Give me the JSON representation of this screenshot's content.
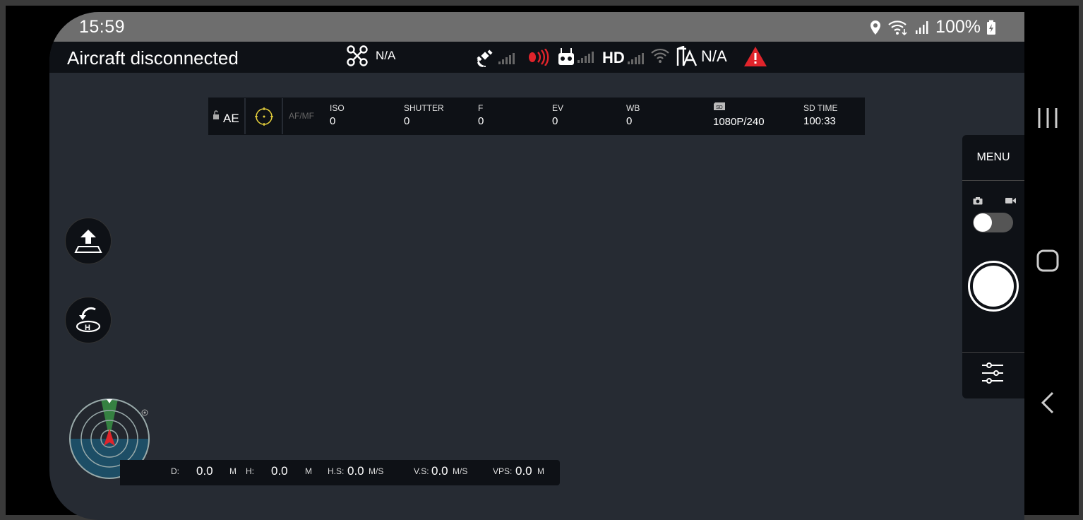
{
  "status_bar": {
    "time": "15:59",
    "battery": "100%"
  },
  "top_bar": {
    "connection_status": "Aircraft disconnected",
    "aircraft_mode": "N/A",
    "obstacle_value": "N/A",
    "signal_label": "HD"
  },
  "camera_strip": {
    "ae_label": "AE",
    "focus_mode": "AF/MF",
    "params": [
      {
        "label": "ISO",
        "value": "0"
      },
      {
        "label": "SHUTTER",
        "value": "0"
      },
      {
        "label": "F",
        "value": "0"
      },
      {
        "label": "EV",
        "value": "0"
      },
      {
        "label": "WB",
        "value": "0"
      }
    ],
    "video_format": "1080P/240",
    "sd_time_label": "SD TIME",
    "sd_time_value": "100:33"
  },
  "right_panel": {
    "menu_label": "MENU"
  },
  "telemetry": {
    "distance_label": "D:",
    "distance_value": "0.0",
    "distance_unit": "M",
    "height_label": "H:",
    "height_value": "0.0",
    "height_unit": "M",
    "hspeed_label": "H.S:",
    "hspeed_value": "0.0",
    "hspeed_unit": "M/S",
    "vspeed_label": "V.S:",
    "vspeed_value": "0.0",
    "vspeed_unit": "M/S",
    "vps_label": "VPS:",
    "vps_value": "0.0",
    "vps_unit": "M"
  },
  "colors": {
    "accent_red": "#e0242b",
    "focus_yellow": "#e8d23c",
    "panel_bg": "#0e1116",
    "screen_bg": "#262b33"
  }
}
